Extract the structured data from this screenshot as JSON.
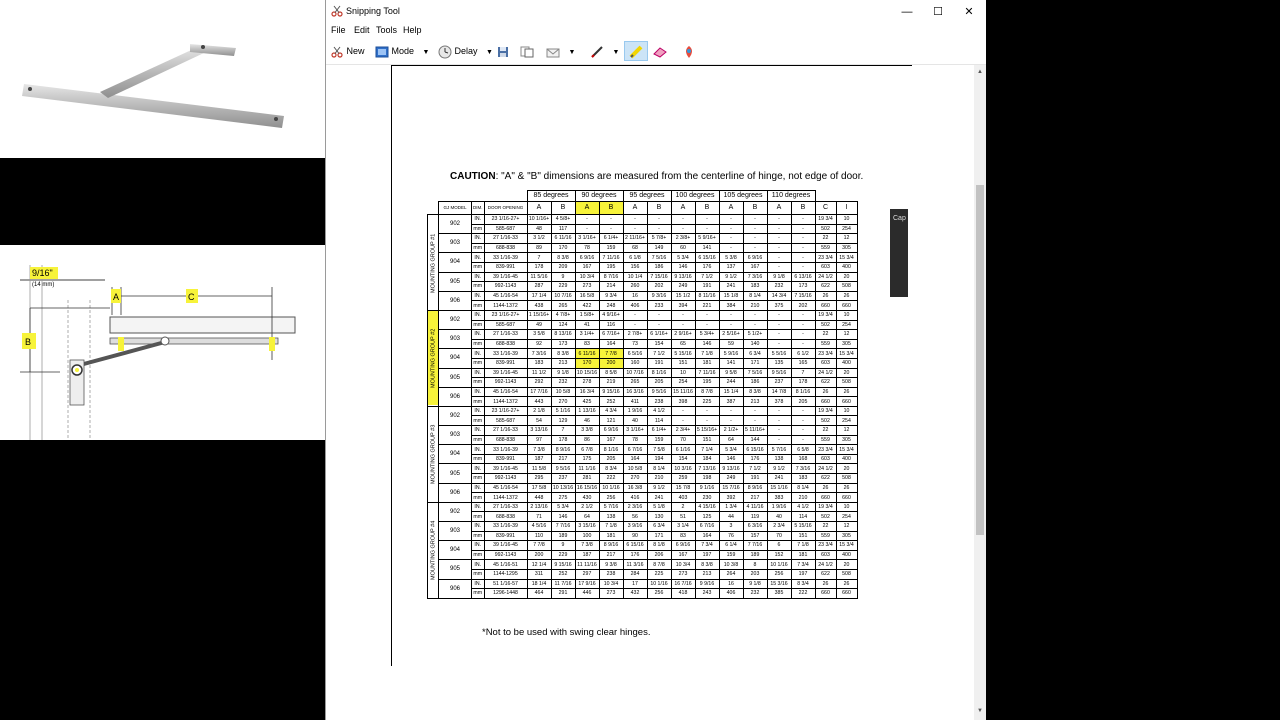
{
  "window": {
    "title": "Snipping Tool",
    "minimize": "—",
    "maximize": "☐",
    "close": "✕"
  },
  "menu": [
    "File",
    "Edit",
    "Tools",
    "Help"
  ],
  "toolbar": {
    "new_label": "New",
    "mode_label": "Mode",
    "delay_label": "Delay"
  },
  "side_panel_label": "Cap",
  "diagram": {
    "dim_label": "9/16\"",
    "dim_sub": "(14 mm)",
    "a_label": "A",
    "b_label": "B",
    "c_label": "C"
  },
  "document": {
    "caution_bold": "CAUTION",
    "caution_text": ": \"A\" & \"B\" dimensions are measured from the centerline of hinge, not edge of door.",
    "footnote": "*Not to be used with swing clear hinges.",
    "angles": [
      "85 degrees",
      "90 degrees",
      "95 degrees",
      "100 degrees",
      "105 degrees",
      "110 degrees"
    ],
    "hdr": {
      "model": "GJ MODEL",
      "dim": "DIM.",
      "door": "DOOR OPENING",
      "c": "C",
      "i": "I"
    },
    "ab": [
      "A",
      "B",
      "A",
      "B",
      "A",
      "B",
      "A",
      "B",
      "A",
      "B",
      "A",
      "B"
    ],
    "groups": [
      "MOUNTING GROUP #1",
      "MOUNTING GROUP #2",
      "MOUNTING GROUP #3",
      "MOUNTING GROUP #4"
    ],
    "units": [
      "IN.",
      "mm"
    ],
    "rows": [
      {
        "g": 0,
        "m": "902",
        "o": [
          "23 1/16-27+",
          "585-687"
        ],
        "v": [
          [
            "10 1/16+",
            "4 5/8+",
            "-",
            "-",
            "-",
            "-",
            "-",
            "-",
            "-",
            "-",
            "-",
            "-",
            "19 3/4",
            "10"
          ],
          [
            "48",
            "117",
            "-",
            "-",
            "-",
            "-",
            "-",
            "-",
            "-",
            "-",
            "-",
            "-",
            "502",
            "254"
          ]
        ]
      },
      {
        "g": 0,
        "m": "903",
        "o": [
          "27 1/16-33",
          "688-838"
        ],
        "v": [
          [
            "3 1/2",
            "6 11/16",
            "3 1/16+",
            "6 1/4+",
            "2 11/16+",
            "5 7/8+",
            "2 3/8+",
            "5 9/16+",
            "-",
            "-",
            "-",
            "-",
            "22",
            "12"
          ],
          [
            "89",
            "170",
            "78",
            "159",
            "68",
            "149",
            "60",
            "141",
            "-",
            "-",
            "-",
            "-",
            "559",
            "305"
          ]
        ]
      },
      {
        "g": 0,
        "m": "904",
        "o": [
          "33 1/16-39",
          "839-991"
        ],
        "v": [
          [
            "7",
            "8 3/8",
            "6 9/16",
            "7 11/16",
            "6 1/8",
            "7 5/16",
            "5 3/4",
            "6 15/16",
            "5 3/8",
            "6 9/16",
            "-",
            "-",
            "23 3/4",
            "15 3/4"
          ],
          [
            "178",
            "209",
            "167",
            "195",
            "156",
            "186",
            "146",
            "176",
            "137",
            "167",
            "-",
            "-",
            "603",
            "400"
          ]
        ]
      },
      {
        "g": 0,
        "m": "905",
        "o": [
          "39 1/16-45",
          "992-1143"
        ],
        "v": [
          [
            "11 5/16",
            "9",
            "10 3/4",
            "8 7/16",
            "10 1/4",
            "7 15/16",
            "9 13/16",
            "7 1/2",
            "9 1/2",
            "7 3/16",
            "9 1/8",
            "6 13/16",
            "24 1/2",
            "20"
          ],
          [
            "287",
            "229",
            "273",
            "214",
            "260",
            "202",
            "249",
            "191",
            "241",
            "183",
            "232",
            "173",
            "622",
            "508"
          ]
        ]
      },
      {
        "g": 0,
        "m": "906",
        "o": [
          "45 1/16-54",
          "1144-1372"
        ],
        "v": [
          [
            "17 1/4",
            "10 7/16",
            "16 5/8",
            "9 3/4",
            "16",
            "9 3/16",
            "15 1/2",
            "8 11/16",
            "15 1/8",
            "8 1/4",
            "14 3/4",
            "7 15/16",
            "26",
            "26"
          ],
          [
            "438",
            "265",
            "422",
            "248",
            "406",
            "233",
            "394",
            "221",
            "384",
            "210",
            "375",
            "202",
            "660",
            "660"
          ]
        ]
      },
      {
        "g": 1,
        "m": "902",
        "o": [
          "23 1/16-27+",
          "585-687"
        ],
        "v": [
          [
            "1 15/16+",
            "4 7/8+",
            "1 5/8+",
            "4 9/16+",
            "-",
            "-",
            "-",
            "-",
            "-",
            "-",
            "-",
            "-",
            "19 3/4",
            "10"
          ],
          [
            "49",
            "124",
            "41",
            "116",
            "-",
            "-",
            "-",
            "-",
            "-",
            "-",
            "-",
            "-",
            "502",
            "254"
          ]
        ]
      },
      {
        "g": 1,
        "m": "903",
        "o": [
          "27 1/16-33",
          "688-838"
        ],
        "v": [
          [
            "3 5/8",
            "8 13/16",
            "3 1/4+",
            "6 7/16+",
            "2 7/8+",
            "6 1/16+",
            "2 9/16+",
            "5 3/4+",
            "2 5/16+",
            "5 1/2+",
            "-",
            "-",
            "22",
            "12"
          ],
          [
            "92",
            "173",
            "83",
            "164",
            "73",
            "154",
            "65",
            "146",
            "59",
            "140",
            "-",
            "-",
            "559",
            "305"
          ]
        ]
      },
      {
        "g": 1,
        "m": "904",
        "o": [
          "33 1/16-39",
          "839-991"
        ],
        "v": [
          [
            "7 3/16",
            "8 3/8",
            "6 11/16",
            "7 7/8",
            "6 5/16",
            "7 1/2",
            "5 15/16",
            "7 1/8",
            "5 9/16",
            "6 3/4",
            "5 5/16",
            "6 1/2",
            "23 3/4",
            "15 3/4"
          ],
          [
            "183",
            "213",
            "170",
            "200",
            "160",
            "191",
            "151",
            "181",
            "141",
            "171",
            "135",
            "165",
            "603",
            "400"
          ]
        ]
      },
      {
        "g": 1,
        "m": "905",
        "o": [
          "39 1/16-45",
          "992-1143"
        ],
        "v": [
          [
            "11 1/2",
            "9 1/8",
            "10 15/16",
            "8 5/8",
            "10 7/16",
            "8 1/16",
            "10",
            "7 11/16",
            "9 5/8",
            "7 5/16",
            "9 5/16",
            "7",
            "24 1/2",
            "20"
          ],
          [
            "292",
            "232",
            "278",
            "219",
            "265",
            "205",
            "254",
            "195",
            "244",
            "186",
            "237",
            "178",
            "622",
            "508"
          ]
        ]
      },
      {
        "g": 1,
        "m": "906",
        "o": [
          "45 1/16-54",
          "1144-1372"
        ],
        "v": [
          [
            "17 7/16",
            "10 5/8",
            "16 3/4",
            "9 15/16",
            "16 3/16",
            "9 5/16",
            "15 11/16",
            "8 7/8",
            "15 1/4",
            "8 3/8",
            "14 7/8",
            "8 1/16",
            "26",
            "26"
          ],
          [
            "443",
            "270",
            "425",
            "252",
            "411",
            "238",
            "398",
            "225",
            "387",
            "213",
            "378",
            "205",
            "660",
            "660"
          ]
        ]
      },
      {
        "g": 2,
        "m": "902",
        "o": [
          "23 1/16-27+",
          "585-687"
        ],
        "v": [
          [
            "2 1/8",
            "5 1/16",
            "1 13/16",
            "4 3/4",
            "1 9/16",
            "4 1/2",
            "-",
            "-",
            "-",
            "-",
            "-",
            "-",
            "19 3/4",
            "10"
          ],
          [
            "54",
            "129",
            "46",
            "121",
            "40",
            "114",
            "-",
            "-",
            "-",
            "-",
            "-",
            "-",
            "502",
            "254"
          ]
        ]
      },
      {
        "g": 2,
        "m": "903",
        "o": [
          "27 1/16-33",
          "688-838"
        ],
        "v": [
          [
            "3 13/16",
            "7",
            "3 3/8",
            "6 9/16",
            "3 1/16+",
            "6 1/4+",
            "2 3/4+",
            "5 15/16+",
            "2 1/2+",
            "5 11/16+",
            "-",
            "-",
            "22",
            "12"
          ],
          [
            "97",
            "178",
            "86",
            "167",
            "78",
            "159",
            "70",
            "151",
            "64",
            "144",
            "-",
            "-",
            "559",
            "305"
          ]
        ]
      },
      {
        "g": 2,
        "m": "904",
        "o": [
          "33 1/16-39",
          "839-991"
        ],
        "v": [
          [
            "7 3/8",
            "8 9/16",
            "6 7/8",
            "8 1/16",
            "6 7/16",
            "7 5/8",
            "6 1/16",
            "7 1/4",
            "5 3/4",
            "6 15/16",
            "5 7/16",
            "6 5/8",
            "23 3/4",
            "15 3/4"
          ],
          [
            "187",
            "217",
            "175",
            "205",
            "164",
            "194",
            "154",
            "184",
            "146",
            "176",
            "138",
            "168",
            "603",
            "400"
          ]
        ]
      },
      {
        "g": 2,
        "m": "905",
        "o": [
          "39 1/16-45",
          "992-1143"
        ],
        "v": [
          [
            "11 5/8",
            "9 5/16",
            "11 1/16",
            "8 3/4",
            "10 5/8",
            "8 1/4",
            "10 3/16",
            "7 13/16",
            "9 13/16",
            "7 1/2",
            "9 1/2",
            "7 3/16",
            "24 1/2",
            "20"
          ],
          [
            "295",
            "237",
            "281",
            "222",
            "270",
            "210",
            "259",
            "198",
            "249",
            "191",
            "241",
            "183",
            "622",
            "508"
          ]
        ]
      },
      {
        "g": 2,
        "m": "906",
        "o": [
          "45 1/16-54",
          "1144-1372"
        ],
        "v": [
          [
            "17 5/8",
            "10 13/16",
            "16 15/16",
            "10 1/16",
            "16 3/8",
            "9 1/2",
            "15 7/8",
            "9 1/16",
            "15 7/16",
            "8 9/16",
            "15 1/16",
            "8 1/4",
            "26",
            "26"
          ],
          [
            "448",
            "275",
            "430",
            "256",
            "416",
            "241",
            "403",
            "230",
            "392",
            "217",
            "383",
            "210",
            "660",
            "660"
          ]
        ]
      },
      {
        "g": 3,
        "m": "902",
        "o": [
          "27 1/16-33",
          "688-838"
        ],
        "v": [
          [
            "2 13/16",
            "5 3/4",
            "2 1/2",
            "5 7/16",
            "2 3/16",
            "5 1/8",
            "2",
            "4 15/16",
            "1 3/4",
            "4 11/16",
            "1 9/16",
            "4 1/2",
            "19 3/4",
            "10"
          ],
          [
            "71",
            "146",
            "64",
            "138",
            "56",
            "130",
            "51",
            "125",
            "44",
            "119",
            "40",
            "114",
            "502",
            "254"
          ]
        ]
      },
      {
        "g": 3,
        "m": "903",
        "o": [
          "33 1/16-39",
          "839-991"
        ],
        "v": [
          [
            "4 5/16",
            "7 7/16",
            "3 15/16",
            "7 1/8",
            "3 9/16",
            "6 3/4",
            "3 1/4",
            "6 7/16",
            "3",
            "6 3/16",
            "2 3/4",
            "5 15/16",
            "22",
            "12"
          ],
          [
            "110",
            "189",
            "100",
            "181",
            "90",
            "171",
            "83",
            "164",
            "76",
            "157",
            "70",
            "151",
            "559",
            "305"
          ]
        ]
      },
      {
        "g": 3,
        "m": "904",
        "o": [
          "39 1/16-45",
          "992-1143"
        ],
        "v": [
          [
            "7 7/8",
            "9",
            "7 3/8",
            "8 9/16",
            "6 15/16",
            "8 1/8",
            "6 9/16",
            "7 3/4",
            "6 1/4",
            "7 7/16",
            "6",
            "7 1/8",
            "23 3/4",
            "15 3/4"
          ],
          [
            "200",
            "229",
            "187",
            "217",
            "176",
            "206",
            "167",
            "197",
            "159",
            "189",
            "152",
            "181",
            "603",
            "400"
          ]
        ]
      },
      {
        "g": 3,
        "m": "905",
        "o": [
          "45 1/16-51",
          "1144-1295"
        ],
        "v": [
          [
            "12 1/4",
            "9 15/16",
            "11 11/16",
            "9 3/8",
            "11 3/16",
            "8 7/8",
            "10 3/4",
            "8 3/8",
            "10 3/8",
            "8",
            "10 1/16",
            "7 3/4",
            "24 1/2",
            "20"
          ],
          [
            "311",
            "252",
            "297",
            "238",
            "284",
            "225",
            "273",
            "213",
            "264",
            "203",
            "256",
            "197",
            "622",
            "508"
          ]
        ]
      },
      {
        "g": 3,
        "m": "906",
        "o": [
          "51 1/16-57",
          "1296-1448"
        ],
        "v": [
          [
            "18 1/4",
            "11 7/16",
            "17 9/16",
            "10 3/4",
            "17",
            "10 1/16",
            "16 7/16",
            "9 9/16",
            "16",
            "9 1/8",
            "15 3/16",
            "8 3/4",
            "26",
            "26"
          ],
          [
            "464",
            "291",
            "446",
            "273",
            "432",
            "256",
            "418",
            "243",
            "406",
            "232",
            "385",
            "222",
            "660",
            "660"
          ]
        ]
      }
    ]
  }
}
